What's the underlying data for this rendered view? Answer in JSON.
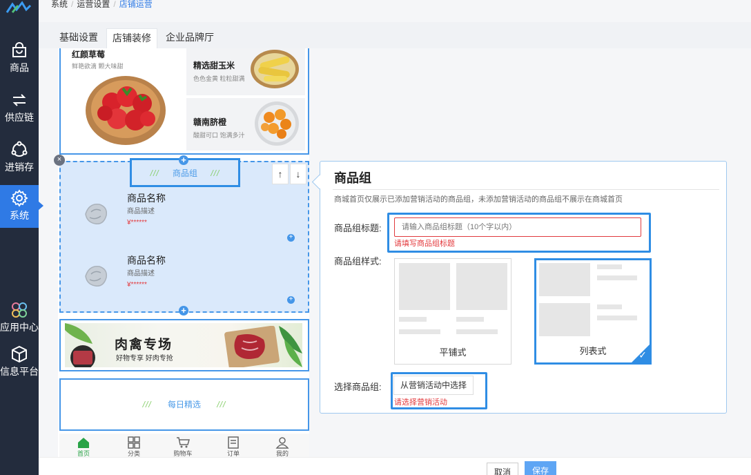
{
  "sidebar": {
    "items": [
      {
        "label": "商品",
        "icon": "shopping-bag-icon"
      },
      {
        "label": "供应链",
        "icon": "swap-arrows-icon"
      },
      {
        "label": "进销存",
        "icon": "cycle-icon"
      },
      {
        "label": "系统",
        "icon": "gear-icon"
      },
      {
        "label": "应用中心",
        "icon": "apps-icon"
      },
      {
        "label": "信息平台",
        "icon": "cube-icon"
      }
    ]
  },
  "breadcrumb": {
    "level1": "系统",
    "level2": "运营设置",
    "level3": "店铺运营",
    "sep": "/"
  },
  "tabs": [
    {
      "label": "基础设置"
    },
    {
      "label": "店铺装修"
    },
    {
      "label": "企业品牌厅"
    }
  ],
  "preview": {
    "fruits": [
      {
        "title": "红颜草莓",
        "sub": "鲜艳欲滴 颗大味甜"
      },
      {
        "title": "精选甜玉米",
        "sub": "色色金黄 粒粒甜满"
      },
      {
        "title": "赣南脐橙",
        "sub": "酸甜可口 饱满多汁"
      }
    ],
    "group_tag": "商品组",
    "slashes": "///",
    "arrow_up": "↑",
    "arrow_down": "↓",
    "products": [
      {
        "name": "商品名称",
        "desc": "商品描述",
        "price": "¥******"
      },
      {
        "name": "商品名称",
        "desc": "商品描述",
        "price": "¥******"
      }
    ],
    "banner_title": "肉禽专场",
    "banner_sub": "好物专享 好肉专抢",
    "daily": "每日精选",
    "tabbar": [
      "首页",
      "分类",
      "购物车",
      "订单",
      "我的"
    ]
  },
  "panel": {
    "title": "商品组",
    "desc": "商城首页仅展示已添加营销活动的商品组，未添加营销活动的商品组不展示在商城首页",
    "title_label": "商品组标题:",
    "title_placeholder": "请输入商品组标题（10个字以内）",
    "title_error": "请填写商品组标题",
    "style_label": "商品组样式:",
    "style_options": [
      "平铺式",
      "列表式"
    ],
    "selected_style": "列表式",
    "select_label": "选择商品组:",
    "select_button": "从营销活动中选择",
    "select_error": "请选择营销活动"
  },
  "footer": {
    "cancel": "取消",
    "save": "保存"
  },
  "colors": {
    "accent": "#2f7ae5",
    "sidebar": "#232c3d",
    "error": "#e3393c",
    "slash": "#86cf6a"
  }
}
